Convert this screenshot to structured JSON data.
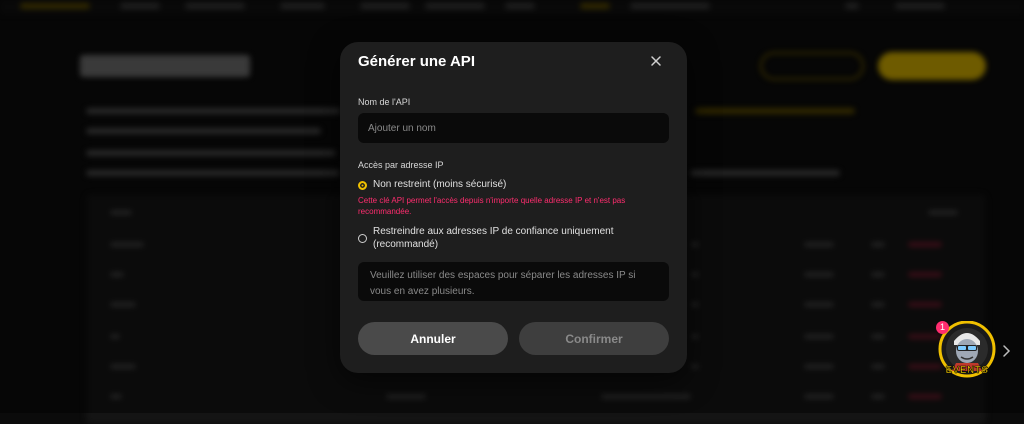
{
  "modal": {
    "title": "Générer une API",
    "name_label": "Nom de l'API",
    "name_placeholder": "Ajouter un nom",
    "ip_section_label": "Accès par adresse IP",
    "options": [
      {
        "label": "Non restreint (moins sécurisé)",
        "selected": true
      },
      {
        "label": "Restreindre aux adresses IP de confiance uniquement (recommandé)",
        "selected": false
      }
    ],
    "warning": "Cette clé API permet l'accès depuis n'importe quelle adresse IP et n'est pas recommandée.",
    "ip_placeholder": "Veuillez utiliser des espaces pour séparer les adresses IP si vous en avez plusieurs.",
    "cancel_label": "Annuler",
    "confirm_label": "Confirmer"
  },
  "events_widget": {
    "badge_count": "1",
    "label": "EVENTS"
  },
  "colors": {
    "accent": "#f0c000",
    "warning": "#ff2d6f",
    "modal_bg": "#1e1e1e"
  },
  "icons": {
    "close": "close-icon",
    "chevron": "chevron-right-icon"
  }
}
